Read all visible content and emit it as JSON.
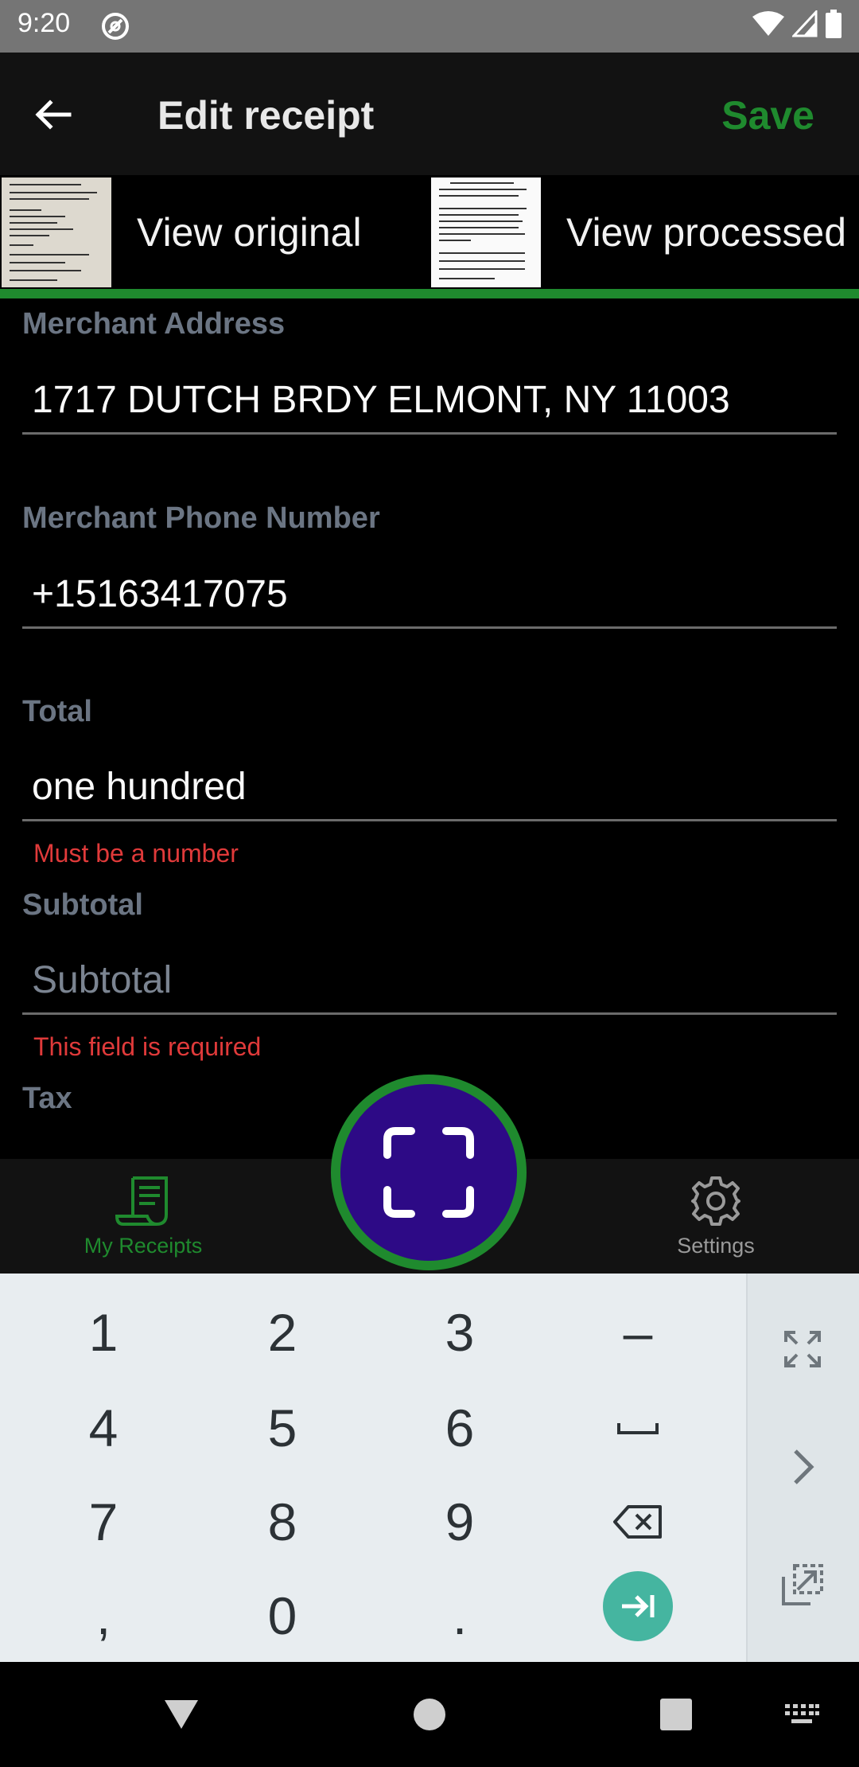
{
  "status_bar": {
    "time": "9:20"
  },
  "toolbar": {
    "title": "Edit receipt",
    "save_label": "Save"
  },
  "image_tabs": {
    "original_label": "View original",
    "processed_label": "View processed"
  },
  "form": {
    "merchant_address": {
      "label": "Merchant Address",
      "value": "1717 DUTCH BRDY ELMONT, NY 11003"
    },
    "merchant_phone": {
      "label": "Merchant Phone Number",
      "value": "+15163417075"
    },
    "total": {
      "label": "Total",
      "value": "one hundred",
      "error": "Must be a number"
    },
    "subtotal": {
      "label": "Subtotal",
      "value": "",
      "placeholder": "Subtotal",
      "error": "This field is required"
    },
    "tax": {
      "label": "Tax"
    }
  },
  "bottom_nav": {
    "receipts_label": "My Receipts",
    "settings_label": "Settings",
    "active": "My Receipts",
    "accent_color": "#1f8a2e",
    "fab_color": "#2d0a86"
  },
  "keyboard": {
    "keys": [
      "1",
      "2",
      "3",
      "–",
      "4",
      "5",
      "6",
      "␣",
      "7",
      "8",
      "9",
      ",",
      "0",
      "."
    ],
    "icons": [
      "backspace-icon",
      "next-field-icon",
      "fullscreen-icon",
      "chevron-right-icon",
      "popout-icon"
    ]
  }
}
